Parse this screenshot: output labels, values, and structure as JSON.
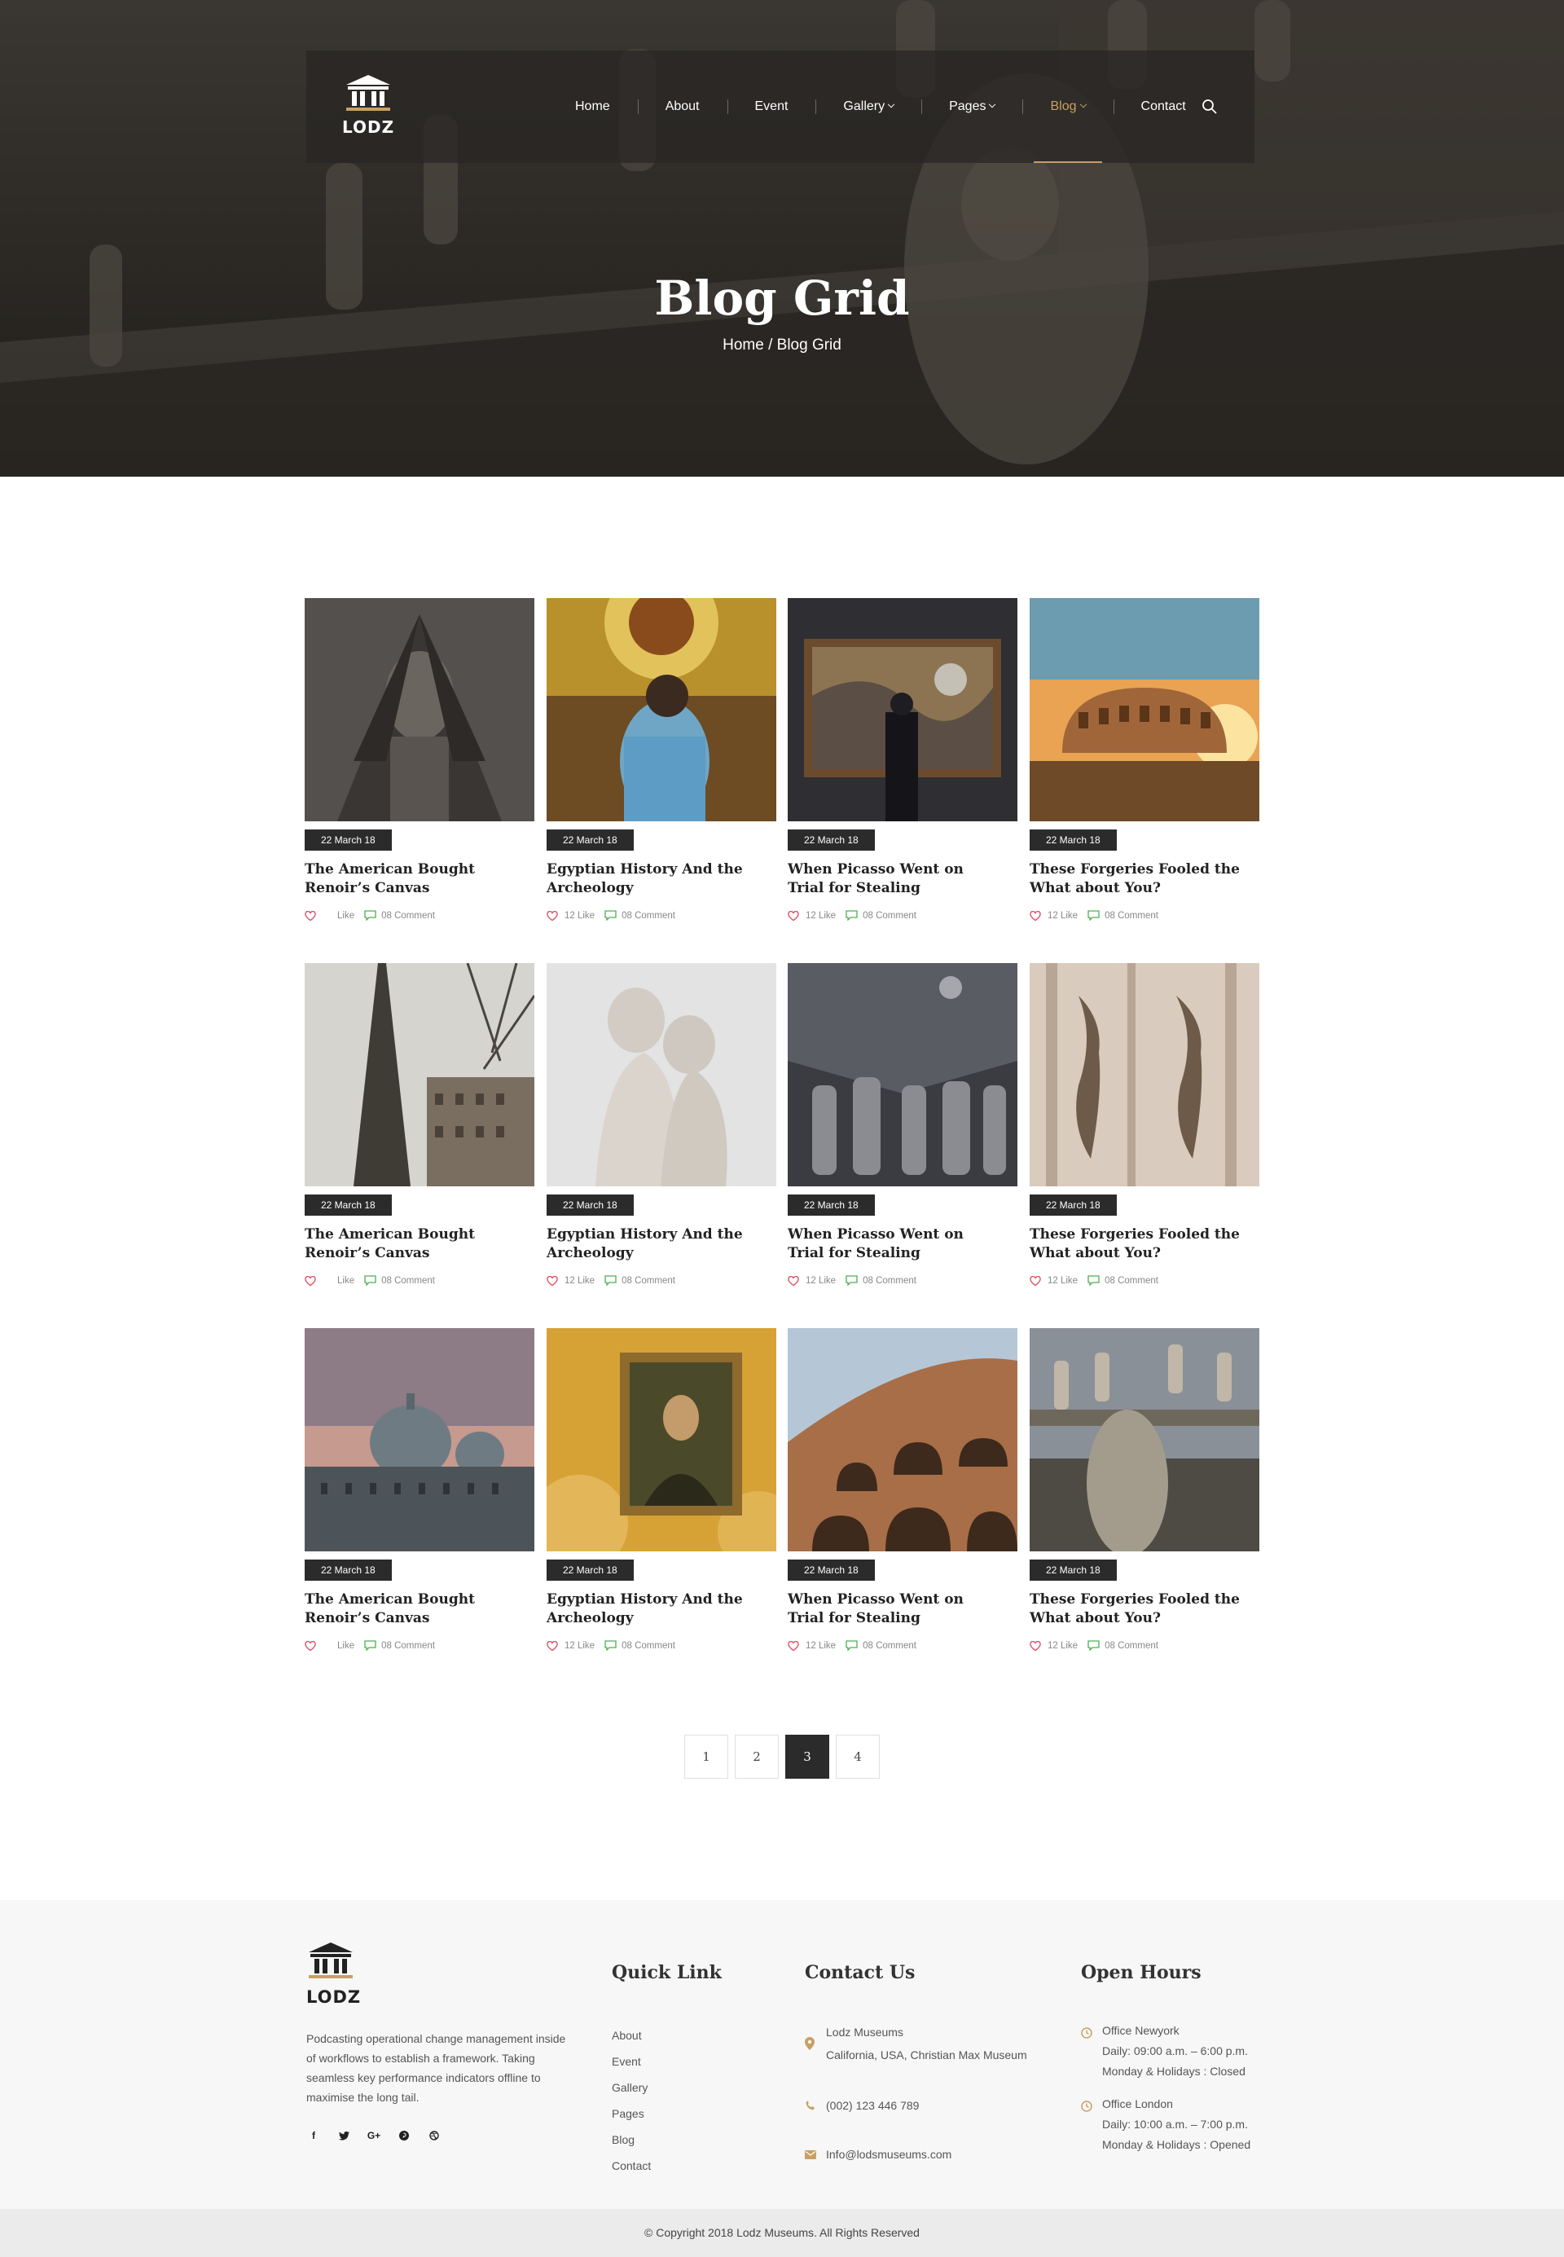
{
  "brand": {
    "name": "LODZ"
  },
  "nav": {
    "items": [
      {
        "label": "Home",
        "dropdown": false,
        "active": false
      },
      {
        "label": "About",
        "dropdown": false,
        "active": false
      },
      {
        "label": "Event",
        "dropdown": false,
        "active": false
      },
      {
        "label": "Gallery",
        "dropdown": true,
        "active": false
      },
      {
        "label": "Pages",
        "dropdown": true,
        "active": false
      },
      {
        "label": "Blog",
        "dropdown": true,
        "active": true
      },
      {
        "label": "Contact",
        "dropdown": false,
        "active": false
      }
    ],
    "search_icon": "search-icon"
  },
  "hero": {
    "title": "Blog Grid",
    "breadcrumb": "Home / Blog Grid"
  },
  "posts": [
    {
      "date": "22 March 18",
      "title": "The American Bought Renoir’s Canvas",
      "likes": "Like",
      "comments": "08 Comment",
      "image": "sphinx"
    },
    {
      "date": "22 March 18",
      "title": "Egyptian History And the Archeology",
      "likes": "12 Like",
      "comments": "08 Comment",
      "image": "ceiling"
    },
    {
      "date": "22 March 18",
      "title": "When Picasso Went on Trial for Stealing",
      "likes": "12 Like",
      "comments": "08 Comment",
      "image": "painting"
    },
    {
      "date": "22 March 18",
      "title": "These Forgeries Fooled the What about You?",
      "likes": "12 Like",
      "comments": "08 Comment",
      "image": "colosseum-sunset"
    },
    {
      "date": "22 March 18",
      "title": "The American Bought Renoir’s Canvas",
      "likes": "Like",
      "comments": "08 Comment",
      "image": "eiffel"
    },
    {
      "date": "22 March 18",
      "title": "Egyptian History And the Archeology",
      "likes": "12 Like",
      "comments": "08 Comment",
      "image": "sculpture"
    },
    {
      "date": "22 March 18",
      "title": "When Picasso Went on Trial for Stealing",
      "likes": "12 Like",
      "comments": "08 Comment",
      "image": "statues-dark"
    },
    {
      "date": "22 March 18",
      "title": "These Forgeries Fooled the What about You?",
      "likes": "12 Like",
      "comments": "08 Comment",
      "image": "cathedral-wall"
    },
    {
      "date": "22 March 18",
      "title": "The American Bought Renoir’s Canvas",
      "likes": "Like",
      "comments": "08 Comment",
      "image": "venice"
    },
    {
      "date": "22 March 18",
      "title": "Egyptian History And the Archeology",
      "likes": "12 Like",
      "comments": "08 Comment",
      "image": "mona-lisa"
    },
    {
      "date": "22 March 18",
      "title": "When Picasso Went on Trial for Stealing",
      "likes": "12 Like",
      "comments": "08 Comment",
      "image": "colosseum-arches"
    },
    {
      "date": "22 March 18",
      "title": "These Forgeries Fooled the What about You?",
      "likes": "12 Like",
      "comments": "08 Comment",
      "image": "st-peters"
    }
  ],
  "pagination": {
    "pages": [
      "1",
      "2",
      "3",
      "4"
    ],
    "current": "3"
  },
  "footer": {
    "about": "Podcasting operational change management inside of workflows to establish a framework. Taking seamless key performance indicators offline to maximise the long tail.",
    "social": [
      "f",
      "t",
      "G+",
      "p",
      "d"
    ],
    "quick_link": {
      "heading": "Quick Link",
      "links": [
        "About",
        "Event",
        "Gallery",
        "Pages",
        "Blog",
        "Contact"
      ]
    },
    "contact": {
      "heading": "Contact Us",
      "name": "Lodz  Museums",
      "address": "California, USA, Christian Max Museum",
      "phone": "(002) 123 446 789",
      "email": "Info@lodsmuseums.com"
    },
    "hours": {
      "heading": "Open Hours",
      "offices": [
        {
          "name": "Office Newyork",
          "daily": "Daily: 09:00 a.m. – 6:00 p.m.",
          "holiday": "Monday & Holidays : Closed"
        },
        {
          "name": "Office London",
          "daily": "Daily: 10:00 a.m. – 7:00 p.m.",
          "holiday": "Monday & Holidays : Opened"
        }
      ]
    },
    "copyright": "Copyright 2018 Lodz Museums. All Rights Reserved"
  },
  "colors": {
    "accent": "#c8a064",
    "dark": "#2b2b2b",
    "footer_bg": "#f7f7f7",
    "like": "#e0506a",
    "comment": "#4caf50"
  }
}
